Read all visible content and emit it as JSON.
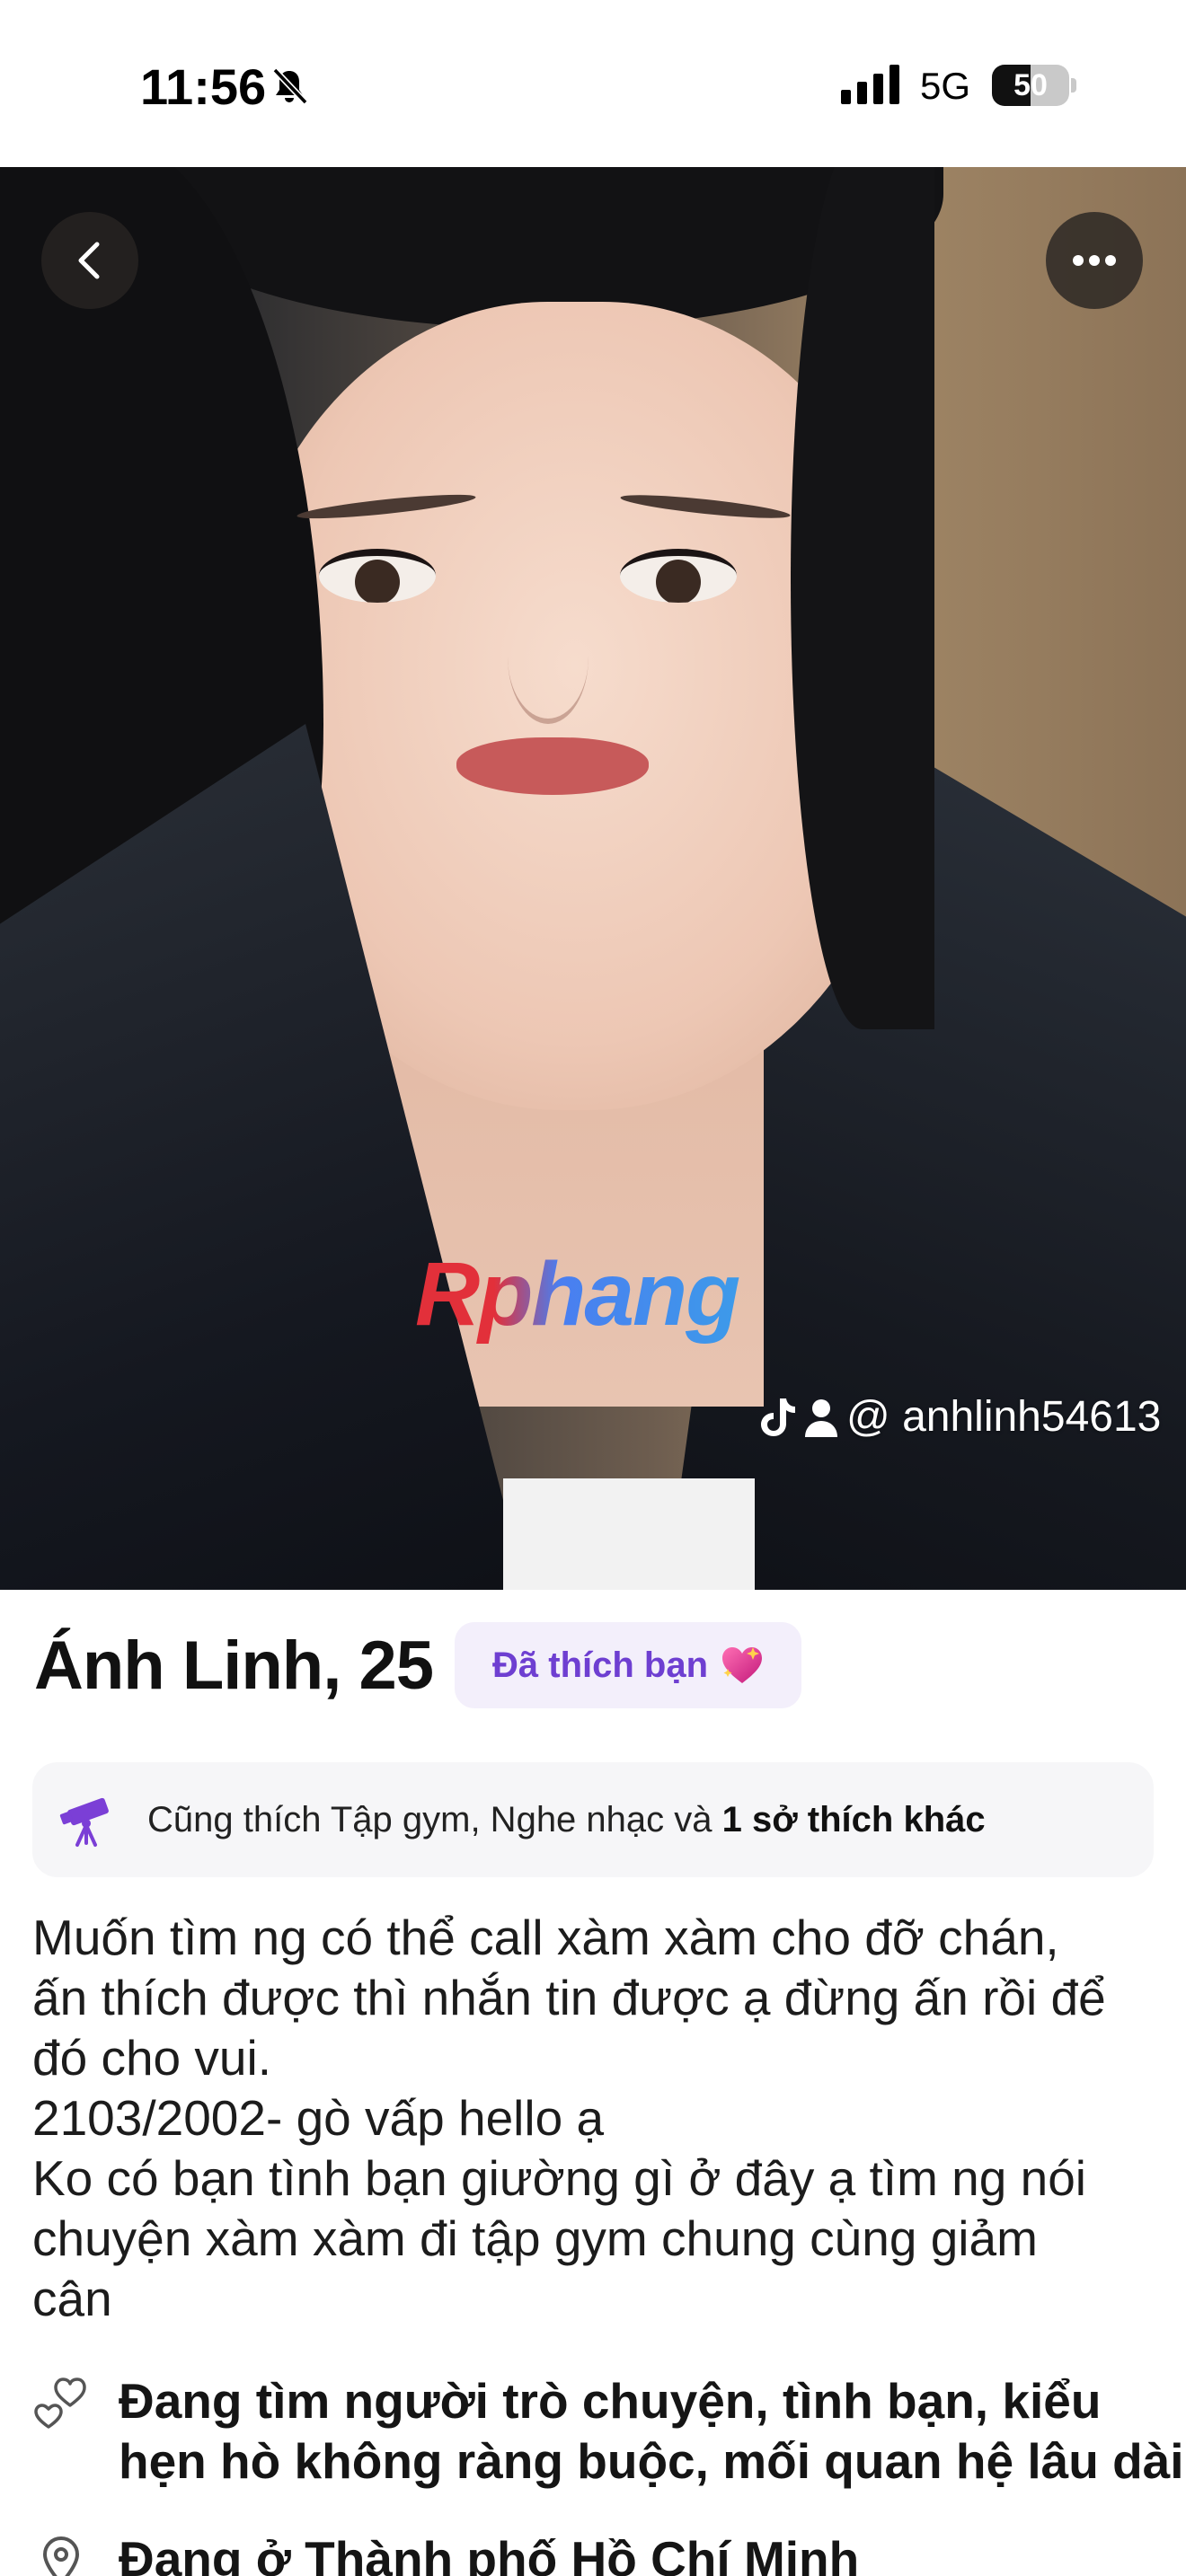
{
  "status_bar": {
    "time": "11:56",
    "network": "5G",
    "battery_percent": "50",
    "battery_level": 0.5,
    "icons": [
      "bell-muted-icon",
      "cellular-signal-icon",
      "battery-icon"
    ]
  },
  "photo": {
    "watermark": "Rphang",
    "tiktok_handle": "@ anhlinh54613",
    "buttons": {
      "back_icon": "chevron-left-icon",
      "more_icon": "ellipsis-icon"
    }
  },
  "profile": {
    "name_age": "Ánh Linh, 25",
    "liked_badge": "Đã thích bạn",
    "interests": {
      "prefix": "Cũng thích Tập gym, Nghe nhạc và ",
      "bold": "1 sở thích khác",
      "icon": "telescope-icon"
    },
    "bio_lines": [
      "Muốn tìm ng có thể call xàm xàm cho đỡ chán,",
      "ấn thích được thì nhắn tin được ạ đừng ấn rồi để",
      "đó cho vui.",
      "2103/2002- gò vấp hello ạ",
      "Ko có bạn tình bạn giường gì ở đây ạ tìm ng nói",
      "chuyện xàm xàm đi tập gym chung cùng giảm",
      "cân"
    ],
    "looking_for": {
      "icon": "hearts-outline-icon",
      "lines": [
        "Đang tìm người trò chuyện, tình bạn, kiểu",
        "hẹn hò không ràng buộc, mối quan hệ lâu dài"
      ]
    },
    "location": {
      "icon": "location-pin-icon",
      "text": "Đang ở Thành phố Hồ Chí Minh"
    }
  },
  "colors": {
    "accent_purple": "#6e3fd1",
    "badge_bg": "#f3effb",
    "card_bg": "#f6f6f8"
  }
}
